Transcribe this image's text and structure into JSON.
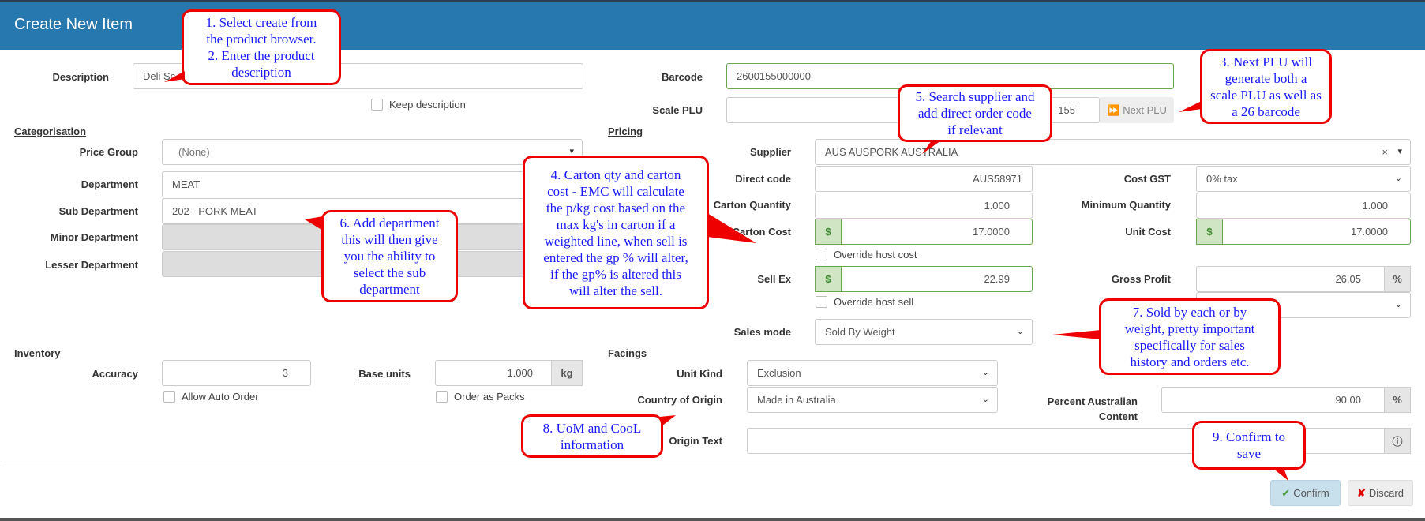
{
  "header": {
    "title": "Create New Item"
  },
  "description": {
    "label": "Description",
    "value": "Deli Sc",
    "keep_label": "Keep description"
  },
  "barcode": {
    "label": "Barcode",
    "value": "2600155000000"
  },
  "scale_plu": {
    "label": "Scale PLU",
    "value": "155",
    "next_label": "Next PLU",
    "next_icon": "fast-forward-icon"
  },
  "categorisation": {
    "title": "Categorisation",
    "price_group": {
      "label": "Price Group",
      "value": "(None)"
    },
    "department": {
      "label": "Department",
      "value": "MEAT"
    },
    "sub_department": {
      "label": "Sub Department",
      "value": "202 - PORK MEAT"
    },
    "minor_department": {
      "label": "Minor Department",
      "value": ""
    },
    "lesser_department": {
      "label": "Lesser Department",
      "value": ""
    }
  },
  "pricing": {
    "title": "Pricing",
    "supplier": {
      "label": "Supplier",
      "value": "AUS AUSPORK AUSTRALIA",
      "clear": "×"
    },
    "direct_code": {
      "label": "Direct code",
      "value": "AUS58971"
    },
    "cost_gst": {
      "label": "Cost GST",
      "value": "0% tax"
    },
    "carton_quantity": {
      "label": "Carton Quantity",
      "value": "1.000"
    },
    "minimum_quantity": {
      "label": "Minimum Quantity",
      "value": "1.000"
    },
    "carton_cost": {
      "label": "Carton Cost",
      "value": "17.0000",
      "prefix": "$"
    },
    "unit_cost": {
      "label": "Unit Cost",
      "value": "17.0000",
      "prefix": "$"
    },
    "override_host_cost": "Override host cost",
    "sell_ex": {
      "label": "Sell Ex",
      "value": "22.99",
      "prefix": "$"
    },
    "gross_profit": {
      "label": "Gross Profit",
      "value": "26.05",
      "suffix": "%"
    },
    "override_host_sell": "Override host sell",
    "sales_mode": {
      "label": "Sales mode",
      "value": "Sold By Weight"
    }
  },
  "inventory": {
    "title": "Inventory",
    "accuracy": {
      "label": "Accuracy",
      "value": "3"
    },
    "base_units": {
      "label": "Base units",
      "value": "1.000",
      "suffix": "kg"
    },
    "allow_auto_order": "Allow Auto Order",
    "order_as_packs": "Order as Packs"
  },
  "facings": {
    "title": "Facings",
    "unit_kind": {
      "label": "Unit Kind",
      "value": "Exclusion"
    },
    "country_of_origin": {
      "label": "Country of Origin",
      "value": "Made in Australia"
    },
    "percent_australian": {
      "label1": "Percent Australian",
      "label2": "Content",
      "value": "90.00",
      "suffix": "%"
    },
    "origin_text": {
      "label": "Origin Text",
      "value": ""
    }
  },
  "footer": {
    "confirm": "Confirm",
    "discard": "Discard"
  },
  "colors": {
    "header": "#2878b0",
    "callout_border": "#ee0000",
    "callout_text": "#1a1aff",
    "confirm_bg": "#c8dfec"
  },
  "callouts": [
    {
      "line1": "1. Select create from",
      "line2": "the product browser.",
      "line3": "2. Enter the product",
      "line4": "description"
    },
    {
      "line1": "3. Next PLU will",
      "line2": "generate both a",
      "line3": "scale PLU as well as",
      "line4": "a 26 barcode"
    },
    {
      "line1": "4. Carton qty and carton",
      "line2": "cost - EMC will calculate",
      "line3": "the p/kg cost based on the",
      "line4": "max kg's in carton if a",
      "line5": "weighted line, when sell is",
      "line6": "entered the gp % will alter,",
      "line7": "if the gp% is altered this",
      "line8": "will alter the sell."
    },
    {
      "line1": "5. Search supplier and",
      "line2": "add direct order code",
      "line3": "if relevant"
    },
    {
      "line1": "6. Add department",
      "line2": "this will then give",
      "line3": "you the ability to",
      "line4": "select the sub",
      "line5": "department"
    },
    {
      "line1": "7. Sold by each or by",
      "line2": "weight, pretty important",
      "line3": "specifically for sales",
      "line4": "history and orders etc."
    },
    {
      "line1": "8. UoM and CooL",
      "line2": "information"
    },
    {
      "line1": "9. Confirm to",
      "line2": "save"
    }
  ]
}
